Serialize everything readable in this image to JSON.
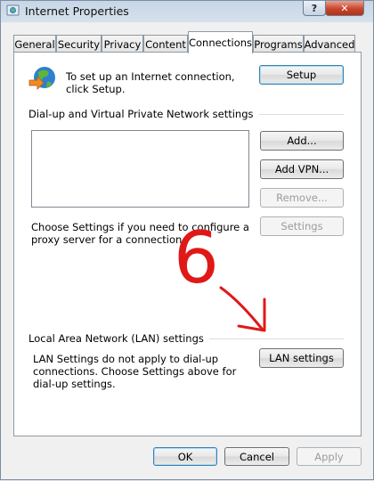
{
  "window": {
    "title": "Internet Properties",
    "help_label": "?",
    "close_label": "✕",
    "icon": "internet-options-icon"
  },
  "tabs": [
    {
      "label": "General"
    },
    {
      "label": "Security"
    },
    {
      "label": "Privacy"
    },
    {
      "label": "Content"
    },
    {
      "label": "Connections"
    },
    {
      "label": "Programs"
    },
    {
      "label": "Advanced"
    }
  ],
  "active_tab": "Connections",
  "connections": {
    "setup_description": "To set up an Internet connection, click Setup.",
    "setup_button": "Setup",
    "dialup_group_label": "Dial-up and Virtual Private Network settings",
    "add_button": "Add...",
    "add_vpn_button": "Add VPN...",
    "remove_button": "Remove...",
    "settings_button": "Settings",
    "proxy_description": "Choose Settings if you need to configure a proxy server for a connection.",
    "lan_group_label": "Local Area Network (LAN) settings",
    "lan_description": "LAN Settings do not apply to dial-up connections. Choose Settings above for dial-up settings.",
    "lan_settings_button": "LAN settings"
  },
  "footer": {
    "ok_button": "OK",
    "cancel_button": "Cancel",
    "apply_button": "Apply"
  },
  "annotation": {
    "step_number": "6",
    "color": "#e01818"
  },
  "colors": {
    "focus_border": "#3c7fb1",
    "close_button": "#c7452d",
    "panel_border": "#8d99a6"
  }
}
